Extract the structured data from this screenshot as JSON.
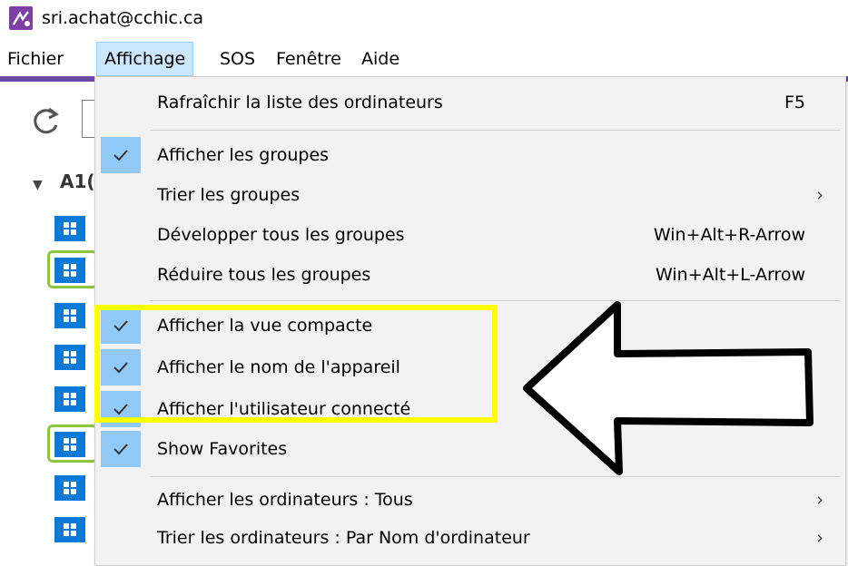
{
  "title": {
    "text": "sri.achat@cchic.ca",
    "icon": "app-logo-icon"
  },
  "menubar": {
    "items": [
      {
        "label": "Fichier"
      },
      {
        "label": "Affichage"
      },
      {
        "label": "SOS"
      },
      {
        "label": "Fenêtre"
      },
      {
        "label": "Aide"
      }
    ],
    "active": "Affichage"
  },
  "panel": {
    "group_label": "A1("
  },
  "dropdown": {
    "items": [
      {
        "label": "Rafraîchir la liste des ordinateurs",
        "shortcut": "F5",
        "checked": false,
        "submenu": false
      },
      {
        "label": "Afficher les groupes",
        "shortcut": "",
        "checked": true,
        "submenu": false
      },
      {
        "label": "Trier les groupes",
        "shortcut": "",
        "checked": false,
        "submenu": true
      },
      {
        "label": "Développer tous les groupes",
        "shortcut": "Win+Alt+R-Arrow",
        "checked": false,
        "submenu": false
      },
      {
        "label": "Réduire tous les groupes",
        "shortcut": "Win+Alt+L-Arrow",
        "checked": false,
        "submenu": false
      },
      {
        "label": "Afficher la vue compacte",
        "shortcut": "",
        "checked": true,
        "submenu": false
      },
      {
        "label": "Afficher le nom de l'appareil",
        "shortcut": "",
        "checked": true,
        "submenu": false
      },
      {
        "label": "Afficher l'utilisateur connecté",
        "shortcut": "",
        "checked": true,
        "submenu": false
      },
      {
        "label": "Show Favorites",
        "shortcut": "",
        "checked": true,
        "submenu": false
      },
      {
        "label": "Afficher les ordinateurs : Tous",
        "shortcut": "",
        "checked": false,
        "submenu": true
      },
      {
        "label": "Trier les ordinateurs : Par Nom d'ordinateur",
        "shortcut": "",
        "checked": false,
        "submenu": true
      }
    ],
    "submenu_glyph": "›"
  },
  "colors": {
    "accent": "#6a4aa3",
    "menu_active": "#cce8ff",
    "check_bg": "#90c8f6",
    "highlight": "#ffff00",
    "tile": "#0a7ad4",
    "favorite_frame": "#8cc63e"
  }
}
